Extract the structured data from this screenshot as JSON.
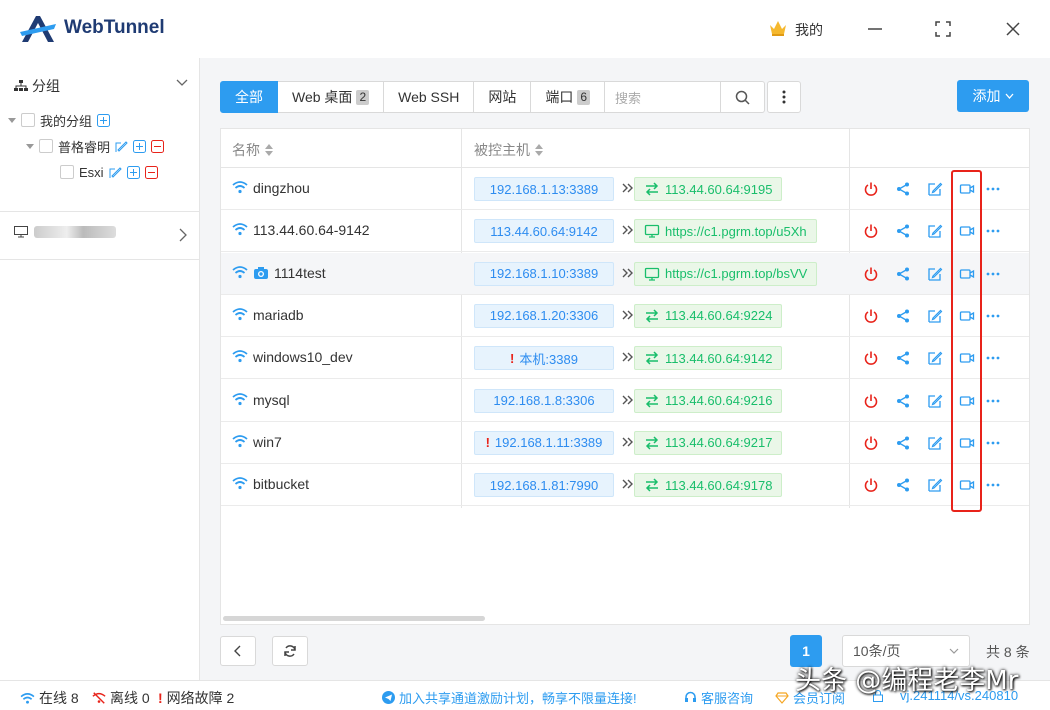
{
  "app": {
    "name": "WebTunnel",
    "user_menu": "我的"
  },
  "sidebar": {
    "group_header": "分组",
    "tree": [
      {
        "label": "我的分组"
      },
      {
        "label": "普格睿明"
      },
      {
        "label": "Esxi"
      }
    ]
  },
  "toolbar": {
    "tabs": [
      {
        "label": "全部",
        "count": ""
      },
      {
        "label": "Web 桌面",
        "count": "2"
      },
      {
        "label": "Web SSH",
        "count": ""
      },
      {
        "label": "网站",
        "count": ""
      },
      {
        "label": "端口",
        "count": "6"
      }
    ],
    "search_placeholder": "搜索",
    "add_label": "添加"
  },
  "table": {
    "columns": {
      "name": "名称",
      "host": "被控主机"
    },
    "rows": [
      {
        "name": "dingzhou",
        "host": "192.168.1.13:3389",
        "target": "113.44.60.64:9195",
        "target_type": "port",
        "warn": false,
        "camera": false
      },
      {
        "name": "113.44.60.64-9142",
        "host": "113.44.60.64:9142",
        "target": "https://c1.pgrm.top/u5Xh",
        "target_type": "web",
        "warn": false,
        "camera": false
      },
      {
        "name": "1114test",
        "host": "192.168.1.10:3389",
        "target": "https://c1.pgrm.top/bsVV",
        "target_type": "web",
        "warn": false,
        "camera": true
      },
      {
        "name": "mariadb",
        "host": "192.168.1.20:3306",
        "target": "113.44.60.64:9224",
        "target_type": "port",
        "warn": false,
        "camera": false
      },
      {
        "name": "windows10_dev",
        "host": "本机:3389",
        "target": "113.44.60.64:9142",
        "target_type": "port",
        "warn": true,
        "camera": false
      },
      {
        "name": "mysql",
        "host": "192.168.1.8:3306",
        "target": "113.44.60.64:9216",
        "target_type": "port",
        "warn": false,
        "camera": false
      },
      {
        "name": "win7",
        "host": "192.168.1.11:3389",
        "target": "113.44.60.64:9217",
        "target_type": "port",
        "warn": true,
        "camera": false
      },
      {
        "name": "bitbucket",
        "host": "192.168.1.81:7990",
        "target": "113.44.60.64:9178",
        "target_type": "port",
        "warn": false,
        "camera": false
      }
    ]
  },
  "pagination": {
    "current": "1",
    "page_size": "10条/页",
    "total": "共 8 条"
  },
  "status": {
    "online": "在线 8",
    "offline": "离线 0",
    "net_fault": "网络故障 2",
    "promo": "加入共享通道激励计划，畅享不限量连接!",
    "support": "客服咨询",
    "membership": "会员订阅",
    "version": "vj.241114/vs.240810"
  },
  "watermark": "头条 @编程老李Mr",
  "colors": {
    "primary": "#2d9cf0",
    "brand": "#1f3b73",
    "danger": "#e8231a",
    "success": "#19be6b"
  }
}
